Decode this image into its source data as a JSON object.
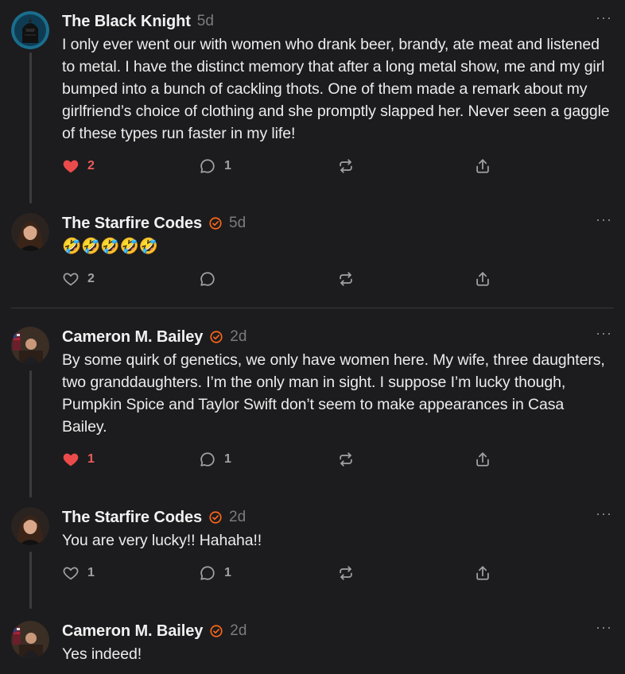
{
  "comments": [
    {
      "author": "The Black Knight",
      "time": "5d",
      "verified": false,
      "text": "I only ever went our with women who drank beer, brandy, ate meat and listened to metal. I have the distinct memory that after a long metal show, me and my girl bumped into a bunch of cackling thots. One of them made a remark about my girlfriend’s choice of clothing and she promptly slapped her. Never seen a gaggle of these types run faster in my life!",
      "likes": "2",
      "liked": true,
      "replies": "1"
    },
    {
      "author": "The Starfire Codes",
      "time": "5d",
      "verified": true,
      "text": "🤣🤣🤣🤣🤣",
      "likes": "2",
      "liked": false,
      "replies": ""
    },
    {
      "author": "Cameron M. Bailey",
      "time": "2d",
      "verified": true,
      "text": "By some quirk of genetics, we only have women here. My wife, three daughters, two granddaughters. I’m the only man in sight. I suppose I’m lucky though, Pumpkin Spice and Taylor Swift don’t seem to make appearances in Casa Bailey.",
      "likes": "1",
      "liked": true,
      "replies": "1"
    },
    {
      "author": "The Starfire Codes",
      "time": "2d",
      "verified": true,
      "text": "You are very lucky!! Hahaha!!",
      "likes": "1",
      "liked": false,
      "replies": "1"
    },
    {
      "author": "Cameron M. Bailey",
      "time": "2d",
      "verified": true,
      "text": "Yes indeed!"
    }
  ],
  "more_glyph": "···",
  "colors": {
    "background": "#1c1c1e",
    "like_red": "#ec5b5b",
    "verified_orange": "#ff6719",
    "muted": "#8e8e93"
  },
  "icons": [
    "heart-icon",
    "comment-icon",
    "restack-icon",
    "share-icon",
    "more-icon",
    "verified-badge-icon"
  ]
}
